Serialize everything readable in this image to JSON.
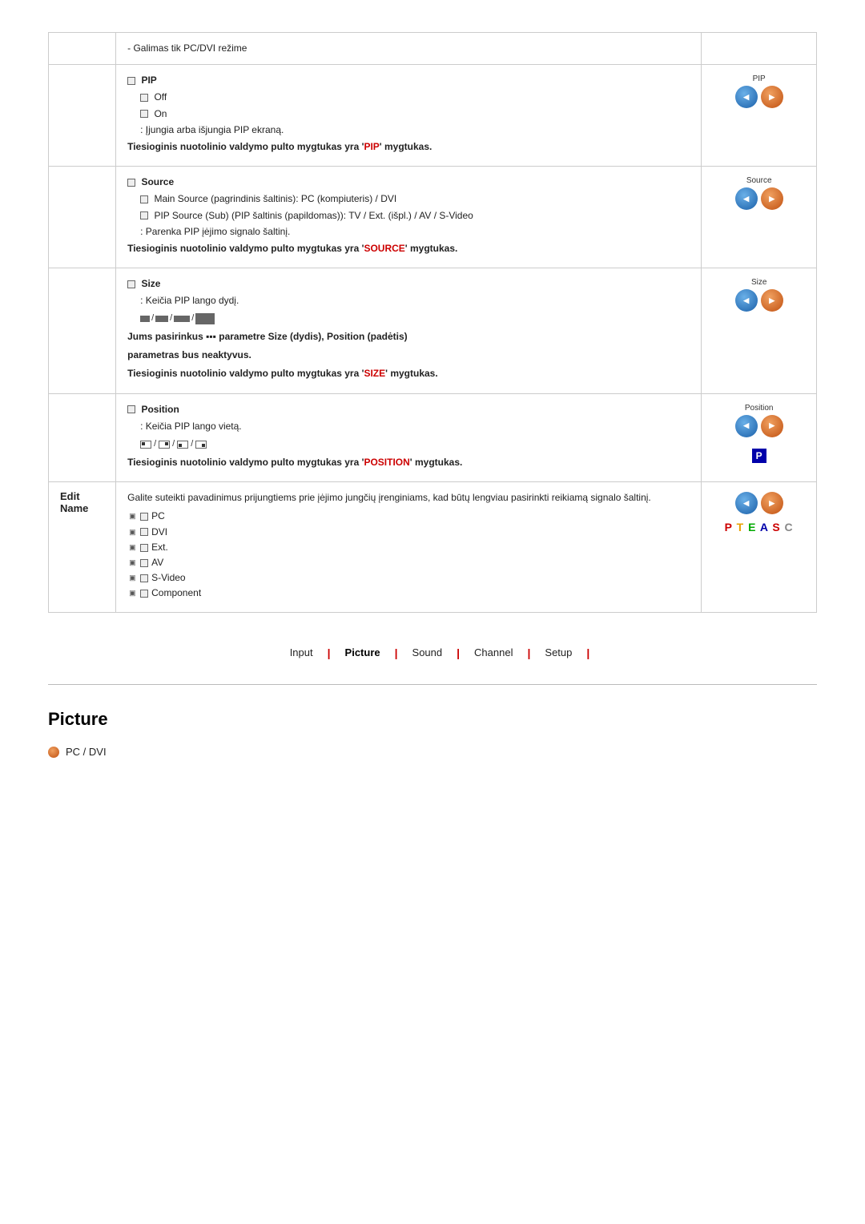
{
  "page": {
    "top_note": "- Galimas tik PC/DVI režime",
    "pip_section": {
      "header": "PIP",
      "off_label": "Off",
      "on_label": "On",
      "note1": ": Įjungia arba išjungia PIP ekraną.",
      "bold_note1": "Tiesioginis nuotolinio valdymo pulto mygtukas yra 'PIP' mygtukas.",
      "highlight1": "PIP"
    },
    "source_section": {
      "header": "Source",
      "sub1": "Main Source (pagrindinis šaltinis): PC (kompiuteris) / DVI",
      "sub2": "PIP Source (Sub) (PIP šaltinis (papildomas)): TV / Ext. (išpl.) / AV / S-Video",
      "note1": ": Parenka PIP įėjimo signalo šaltinį.",
      "bold_note": "Tiesioginis nuotolinio valdymo pulto mygtukas yra 'SOURCE' mygtukas.",
      "highlight": "SOURCE"
    },
    "size_section": {
      "header": "Size",
      "note1": ": Keičia PIP lango dydį.",
      "bold_note1": "Jums pasirinkus ▪▪▪ parametre Size (dydis), Position (padėtis)",
      "bold_note2": "parametras bus neaktyvus.",
      "bold_note3": "Tiesioginis nuotolinio valdymo pulto mygtukas yra 'SIZE' mygtukas.",
      "highlight": "SIZE"
    },
    "position_section": {
      "header": "Position",
      "note1": ": Keičia PIP lango vietą.",
      "bold_note": "Tiesioginis nuotolinio valdymo pulto mygtukas yra 'POSITION' mygtukas.",
      "highlight": "POSITION"
    },
    "edit_name_section": {
      "label": "Edit Name",
      "desc": "Galite suteikti pavadinimus prijungtiems prie įėjimo jungčių įrenginiams, kad būtų lengviau pasirinkti reikiamą signalo šaltinį.",
      "items": [
        "PC",
        "DVI",
        "Ext.",
        "AV",
        "S-Video",
        "Component"
      ]
    }
  },
  "navbar": {
    "items": [
      {
        "id": "input",
        "label": "Input"
      },
      {
        "id": "picture",
        "label": "Picture",
        "active": true
      },
      {
        "id": "sound",
        "label": "Sound"
      },
      {
        "id": "channel",
        "label": "Channel"
      },
      {
        "id": "setup",
        "label": "Setup"
      }
    ]
  },
  "picture_section": {
    "title": "Picture",
    "subsection": "PC / DVI"
  },
  "icons": {
    "pip_label": "PIP",
    "source_label": "Source",
    "size_label": "Size",
    "position_label": "Position",
    "p_square": "P",
    "pteasc": "PTEASC"
  }
}
